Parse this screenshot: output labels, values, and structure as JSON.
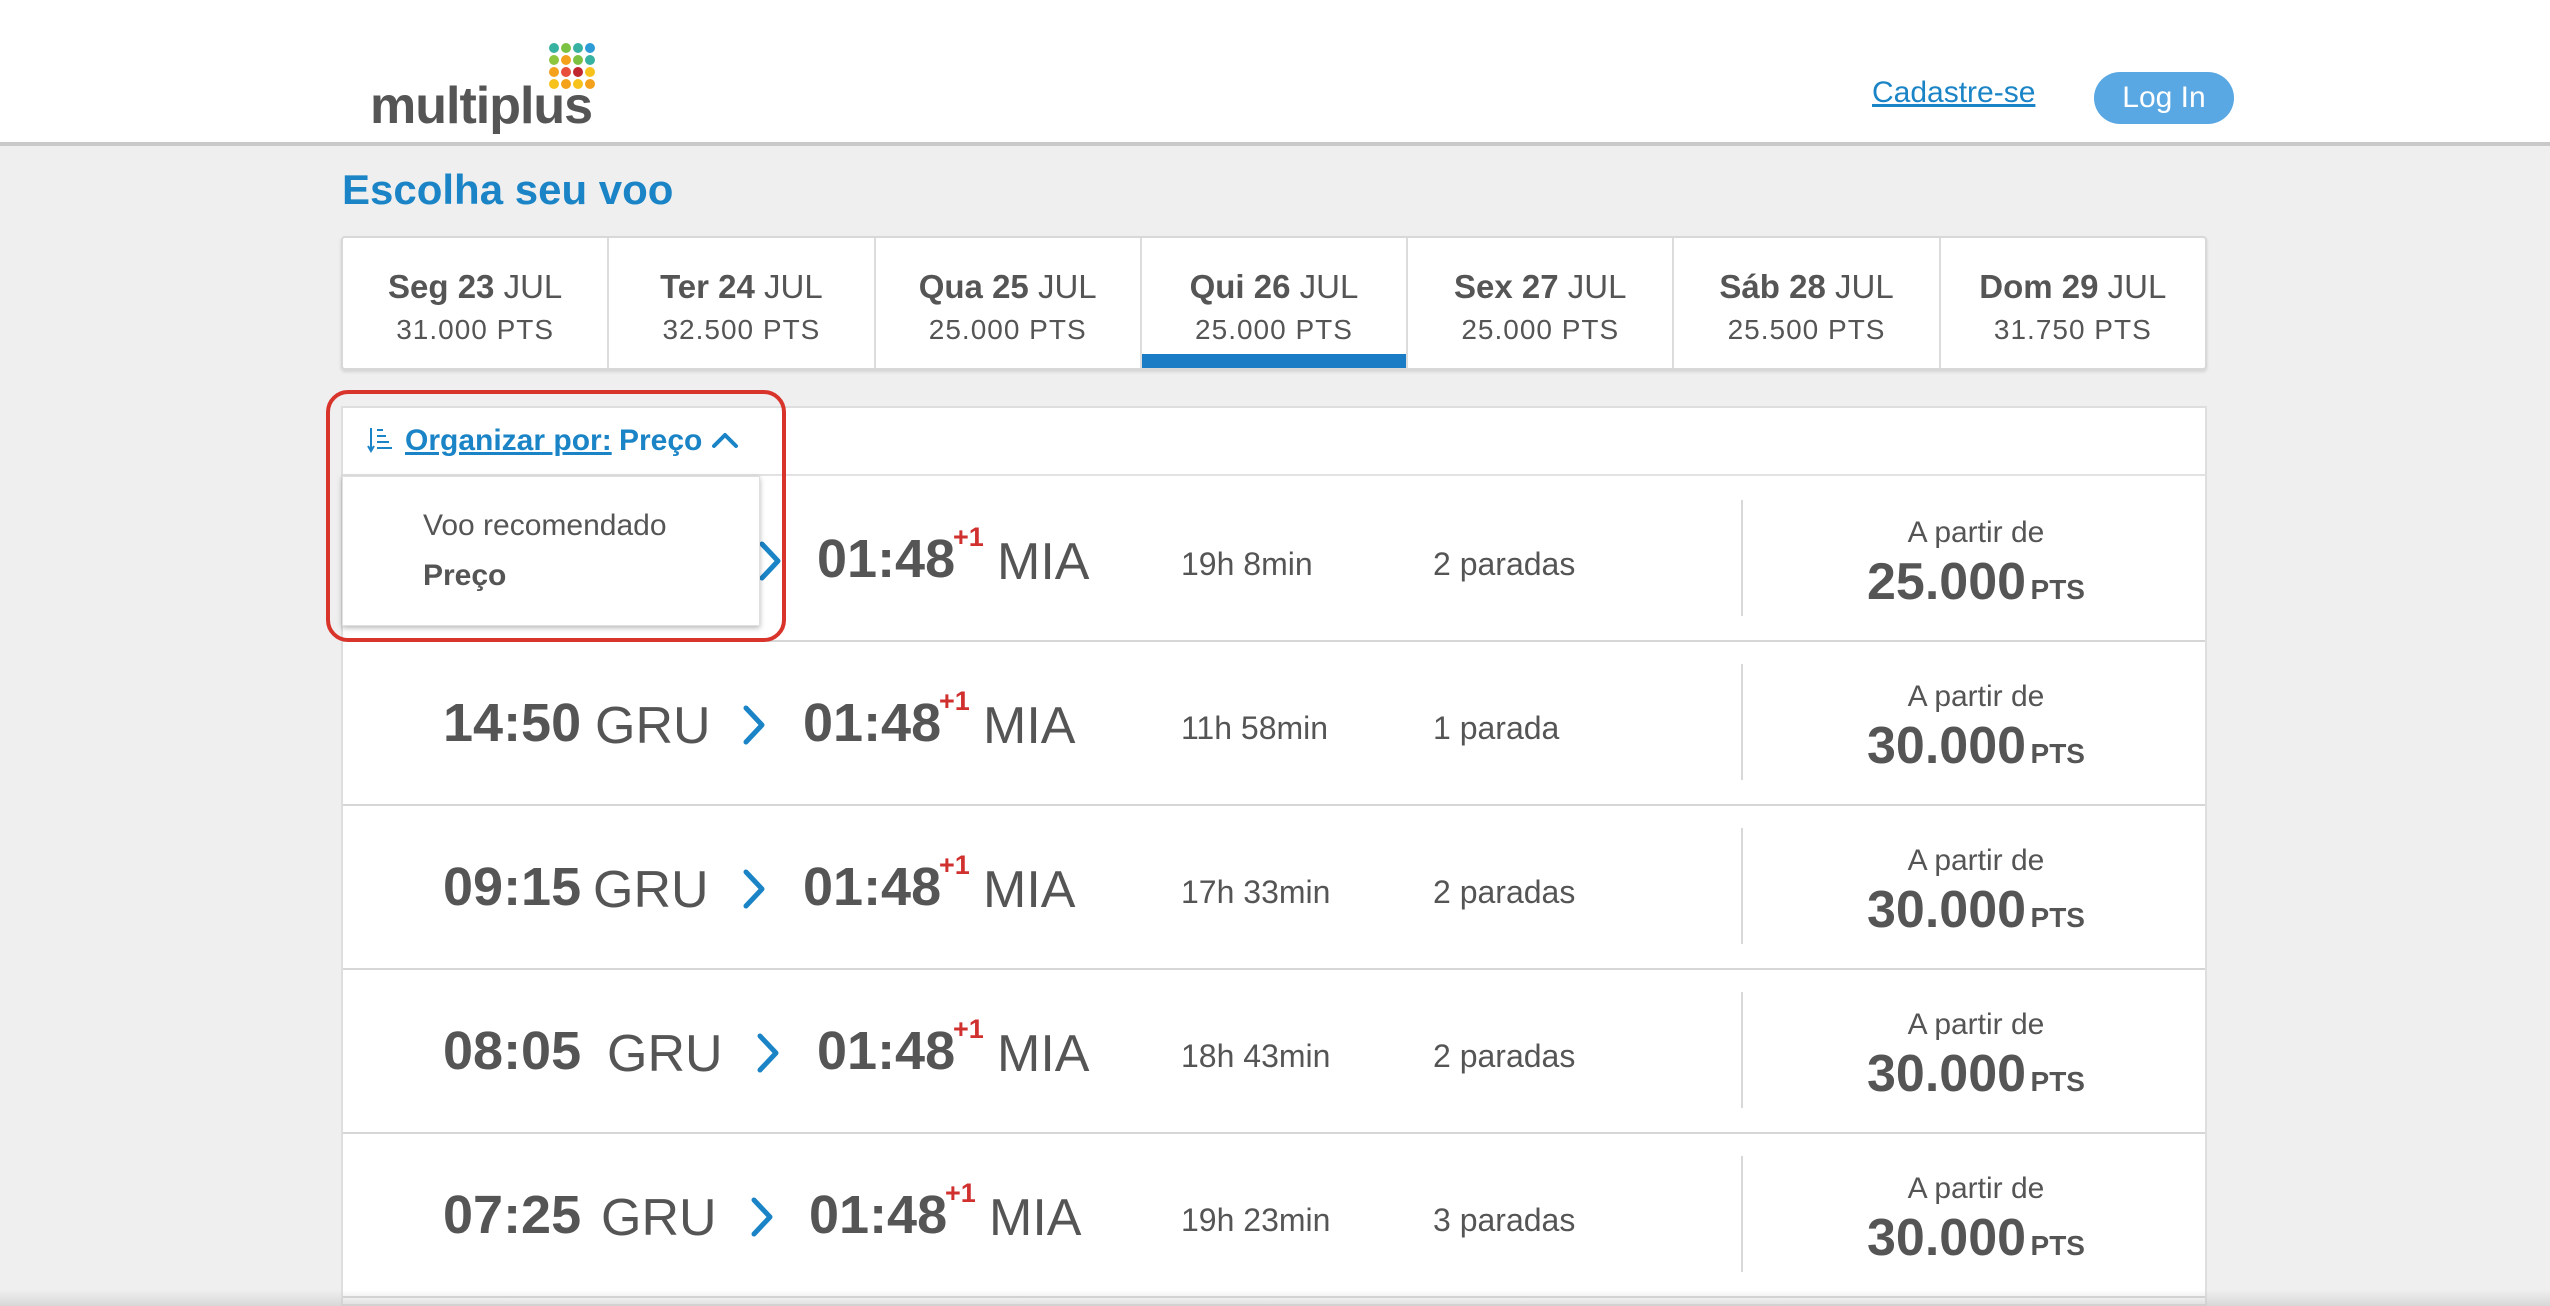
{
  "header": {
    "logo_text": "multiplus",
    "signup_label": "Cadastre-se",
    "login_label": "Log In"
  },
  "page": {
    "title": "Escolha seu voo"
  },
  "dates": [
    {
      "day": "Seg 23",
      "month": "JUL",
      "pts": "31.000 PTS"
    },
    {
      "day": "Ter 24",
      "month": "JUL",
      "pts": "32.500 PTS"
    },
    {
      "day": "Qua 25",
      "month": "JUL",
      "pts": "25.000 PTS"
    },
    {
      "day": "Qui 26",
      "month": "JUL",
      "pts": "25.000 PTS",
      "active": true
    },
    {
      "day": "Sex 27",
      "month": "JUL",
      "pts": "25.000 PTS"
    },
    {
      "day": "Sáb 28",
      "month": "JUL",
      "pts": "25.500 PTS"
    },
    {
      "day": "Dom 29",
      "month": "JUL",
      "pts": "31.750 PTS"
    }
  ],
  "sort": {
    "label": "Organizar por:",
    "value": "Preço",
    "options": [
      "Voo recomendado",
      "Preço"
    ]
  },
  "flights": [
    {
      "dep_time": "",
      "dep_code": "",
      "arr_time": "01:48",
      "plus": "+1",
      "arr_code": "MIA",
      "duration": "19h 8min",
      "stops": "2 paradas",
      "price_caption": "A partir de",
      "price": "25.000",
      "unit": "PTS"
    },
    {
      "dep_time": "14:50",
      "dep_code": "GRU",
      "arr_time": "01:48",
      "plus": "+1",
      "arr_code": "MIA",
      "duration": "11h 58min",
      "stops": "1 parada",
      "price_caption": "A partir de",
      "price": "30.000",
      "unit": "PTS"
    },
    {
      "dep_time": "09:15",
      "dep_code": "GRU",
      "arr_time": "01:48",
      "plus": "+1",
      "arr_code": "MIA",
      "duration": "17h 33min",
      "stops": "2 paradas",
      "price_caption": "A partir de",
      "price": "30.000",
      "unit": "PTS"
    },
    {
      "dep_time": "08:05",
      "dep_code": "GRU",
      "arr_time": "01:48",
      "plus": "+1",
      "arr_code": "MIA",
      "duration": "18h 43min",
      "stops": "2 paradas",
      "price_caption": "A partir de",
      "price": "30.000",
      "unit": "PTS"
    },
    {
      "dep_time": "07:25",
      "dep_code": "GRU",
      "arr_time": "01:48",
      "plus": "+1",
      "arr_code": "MIA",
      "duration": "19h 23min",
      "stops": "3 paradas",
      "price_caption": "A partir de",
      "price": "30.000",
      "unit": "PTS"
    }
  ],
  "colors": {
    "accent": "#1a84c6",
    "login_bg": "#5aa8e3",
    "plus_one": "#d0302e",
    "highlight": "#d9342c"
  },
  "icons": {
    "sort": "sort-icon",
    "chevron": "chevron-up-icon",
    "arrow": "chevron-right-icon"
  }
}
